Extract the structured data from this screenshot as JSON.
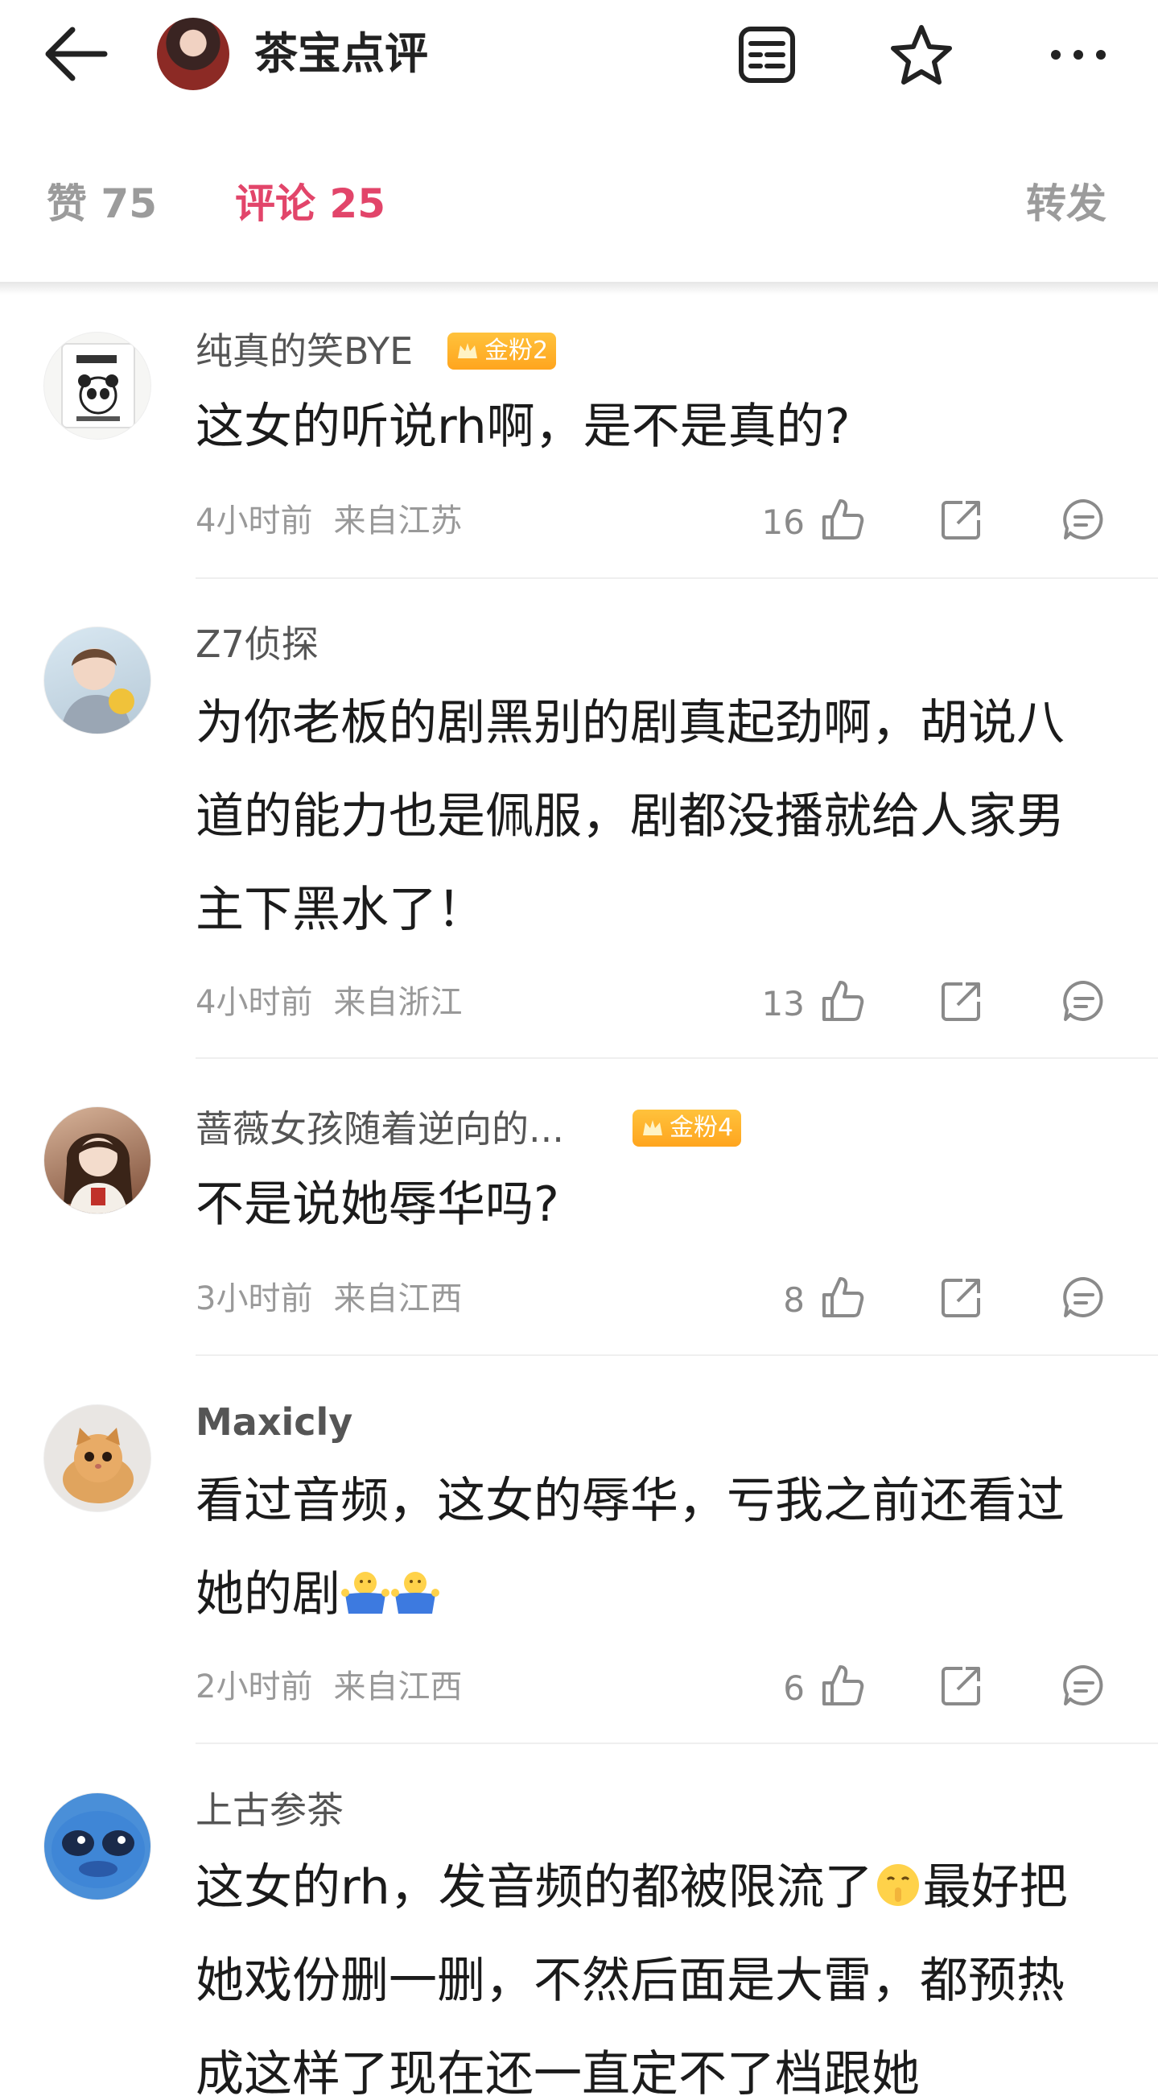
{
  "header": {
    "title": "茶宝点评",
    "back_icon": "arrow-left-icon",
    "doc_icon": "document-list-icon",
    "star_icon": "star-outline-icon",
    "more_icon": "more-horizontal-icon"
  },
  "tabs": {
    "likes": "赞 75",
    "comments": "评论 25",
    "repost": "转发"
  },
  "colors": {
    "accent": "#e2456a",
    "badge": "#ffb12a"
  },
  "comments": [
    {
      "name": "纯真的笑BYE",
      "badge": "金粉2",
      "text": "这女的听说rh啊，是不是真的?",
      "time": "4小时前",
      "location": "来自江苏",
      "likes": "16"
    },
    {
      "name": "Z7侦探",
      "text": "为你老板的剧黑别的剧真起劲啊，胡说八道的能力也是佩服，剧都没播就给人家男主下黑水了！",
      "time": "4小时前",
      "location": "来自浙江",
      "likes": "13"
    },
    {
      "name": "蔷薇女孩随着逆向的...",
      "badge": "金粉4",
      "text": "不是说她辱华吗?",
      "time": "3小时前",
      "location": "来自江西",
      "likes": "8"
    },
    {
      "name": "Maxicly",
      "text": "看过音频，这女的辱华，亏我之前还看过她的剧",
      "time": "2小时前",
      "location": "来自江西",
      "likes": "6"
    },
    {
      "name": "上古参茶",
      "text_a": "这女的rh，发音频的都被限流了",
      "text_b": "最好把她戏份删一删，不然后面是大雷，都预热成这样了现在还一直定不了档跟她"
    }
  ]
}
